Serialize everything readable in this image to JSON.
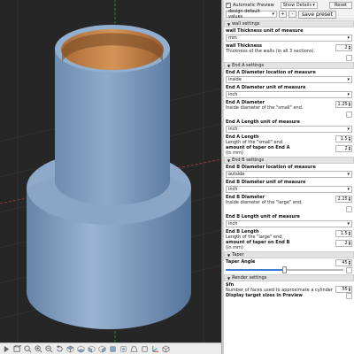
{
  "colors": {
    "viewport_bg": "#262626",
    "model_body": "#8aa6c6",
    "model_inner": "#c9844a",
    "accent": "#3a7bd5",
    "axis_green": "#3f8f3f",
    "axis_red": "#a33b3b"
  },
  "topbar": {
    "auto_preview_checked": "✓",
    "auto_preview_label": "Automatic Preview",
    "details_select": "Show Details",
    "reset_label": "Reset"
  },
  "presets": {
    "selected": "design default values",
    "add_label": "+",
    "remove_label": "-",
    "save_label": "save preset"
  },
  "sections": {
    "wall": {
      "title": "wall settings",
      "thickness_unit_label": "wall Thickness unit of measure",
      "thickness_unit_value": "mm",
      "thickness_label": "wall Thickness",
      "thickness_desc": "Thickness of the walls (in all 3 sections).",
      "thickness_value": "2"
    },
    "end_a": {
      "title": "End A settings",
      "diam_loc_label": "End A Diameter location of measure",
      "diam_loc_value": "inside",
      "diam_unit_label": "End A Diameter unit of measure",
      "diam_unit_value": "inch",
      "diam_label": "End A Diameter",
      "diam_desc": "Inside diameter of the \"small\" end.",
      "diam_value": "1.25",
      "len_unit_label": "End A Length unit of measure",
      "len_unit_value": "inch",
      "len_label": "End A Length",
      "len_desc": "Length of the \"small\" end.",
      "len_value": "1.5",
      "taper_label": "amount of taper on End A",
      "taper_desc": "(in mm)",
      "taper_value": "2"
    },
    "end_b": {
      "title": "End B settings",
      "diam_loc_label": "End B Diameter location of measure",
      "diam_loc_value": "outside",
      "diam_unit_label": "End B Diameter unit of measure",
      "diam_unit_value": "inch",
      "diam_label": "End B Diameter",
      "diam_desc": "Inside diameter of the \"large\" end.",
      "diam_value": "2.25",
      "len_unit_label": "End B Length unit of measure",
      "len_unit_value": "inch",
      "len_label": "End B Length",
      "len_desc": "Length of the \"large\" end.",
      "len_value": "1.5",
      "taper_label": "amount of taper on End B",
      "taper_desc": "(in mm)",
      "taper_value": "2"
    },
    "taper": {
      "title": "Taper",
      "angle_label": "Taper Angle",
      "angle_value": "45",
      "angle_fraction": 0.5
    },
    "render": {
      "title": "Render settings",
      "fn_label": "$fn",
      "fn_desc": "Number of faces used to approximate a cylinder",
      "fn_value": "55",
      "display_label": "Display target sizes in Preview"
    }
  },
  "toolbar_icons": [
    "preview-icon",
    "render-icon",
    "view-all-icon",
    "zoom-in-icon",
    "zoom-out-icon",
    "reset-view-icon",
    "view-top-icon",
    "view-bottom-icon",
    "view-left-icon",
    "view-right-icon",
    "view-front-icon",
    "view-back-icon",
    "perspective-icon",
    "orthogonal-icon",
    "show-axes-icon",
    "show-edges-icon"
  ]
}
